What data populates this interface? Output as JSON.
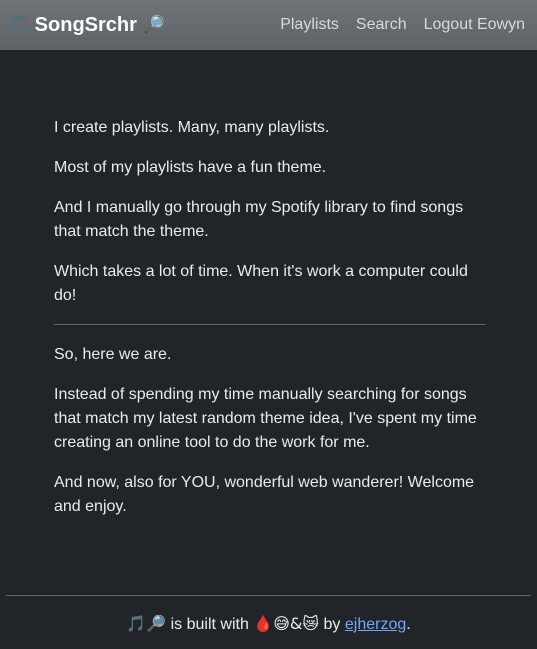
{
  "navbar": {
    "brand_note": "🎵",
    "brand_name": "SongSrchr",
    "brand_icon": "🔎",
    "links": [
      {
        "label": "Playlists"
      },
      {
        "label": "Search"
      },
      {
        "label": "Logout Eowyn"
      }
    ]
  },
  "main": {
    "paragraphs_top": [
      "I create playlists. Many, many playlists.",
      "Most of my playlists have a fun theme.",
      "And I manually go through my Spotify library to find songs that match the theme.",
      "Which takes a lot of time. When it's work a computer could do!"
    ],
    "paragraphs_bottom": [
      "So, here we are.",
      "Instead of spending my time manually searching for songs that match my latest random theme idea, I've spent my time creating an online tool to do the work for me.",
      "And now, also for YOU, wonderful web wanderer! Welcome and enjoy."
    ]
  },
  "footer": {
    "icons": "🎵🔎",
    "text_built": " is built with ",
    "emojis": "🩸😅&😿",
    "text_by": " by ",
    "author": "ejherzog",
    "end": "."
  },
  "colors": {
    "background": "#212529",
    "navbar": "#666b70",
    "link": "#6ea8fe"
  }
}
